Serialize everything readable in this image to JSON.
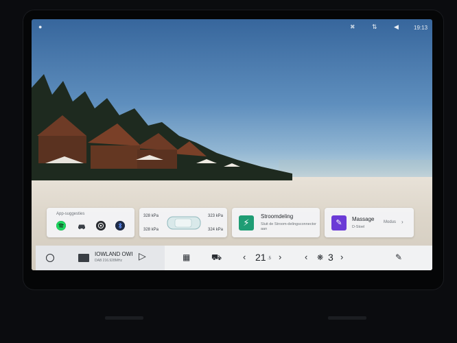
{
  "status_bar": {
    "person_icon": "person-icon",
    "clock": "19:13"
  },
  "app_suggestions": {
    "title": "App-suggesties",
    "icons": [
      "spotify-icon",
      "car-app-icon",
      "connect-icon",
      "bluetooth-icon"
    ]
  },
  "tires": {
    "front_left": "328 kPa",
    "front_right": "323 kPa",
    "rear_left": "328 kPa",
    "rear_right": "324 kPa"
  },
  "power_sharing": {
    "title": "Stroomdeling",
    "subtitle": "Sluit de Stroom-delingsconnector aan"
  },
  "massage": {
    "title": "Massage",
    "subtitle": "D-Stoel",
    "mode_label": "Modus"
  },
  "media": {
    "station": "IOWLAND OWI",
    "frequency": "DAB 216.928MHz"
  },
  "climate": {
    "temperature": "21",
    "temperature_unit": ".5",
    "fan_level": "3"
  },
  "colors": {
    "power_green": "#1f9d74",
    "massage_purple": "#6b3bd6"
  }
}
